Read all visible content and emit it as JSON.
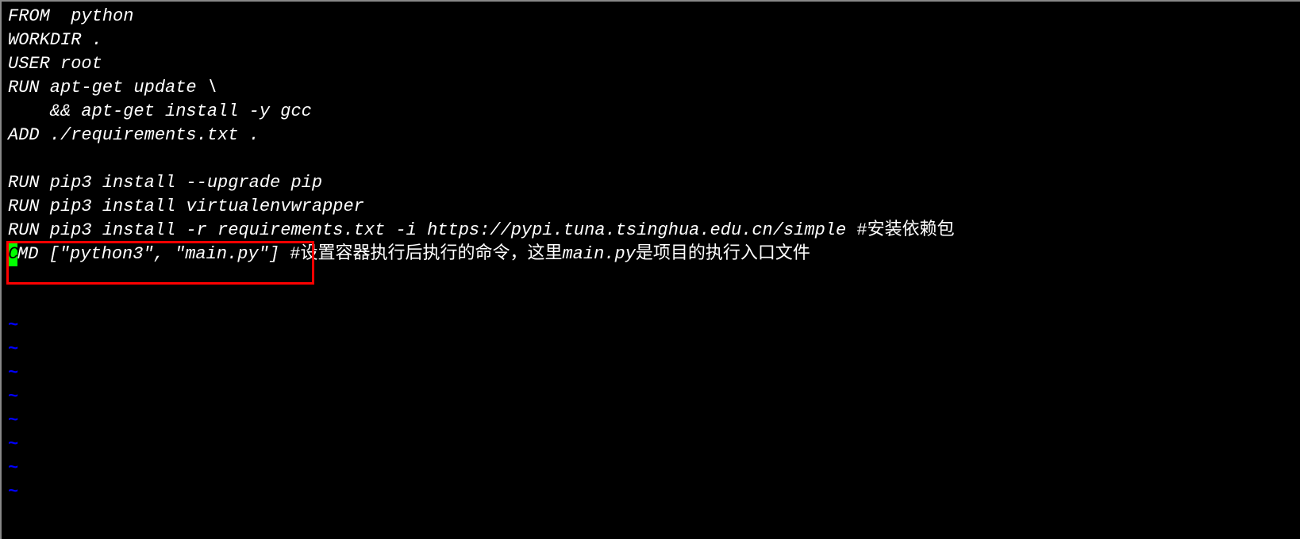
{
  "editor": {
    "lines": {
      "l1": "FROM  python",
      "l2": "WORKDIR .",
      "l3": "USER root",
      "l4": "RUN apt-get update \\",
      "l5": "    && apt-get install -y gcc",
      "l6": "ADD ./requirements.txt .",
      "l7": "",
      "l8": "RUN pip3 install --upgrade pip",
      "l9": "RUN pip3 install virtualenvwrapper",
      "l10_code": "RUN pip3 install -r requirements.txt -i https://pypi.tuna.tsinghua.edu.cn/simple ",
      "l10_comment": "#安装依赖包",
      "l11_cursor_char": "C",
      "l11_code": "MD [\"python3\", \"main.py\"] ",
      "l11_comment_prefix": "#设置容器执行后执行的命令，这里",
      "l11_comment_mid": "main.py",
      "l11_comment_suffix": "是项目的执行入口文件"
    },
    "tilde": "~"
  }
}
